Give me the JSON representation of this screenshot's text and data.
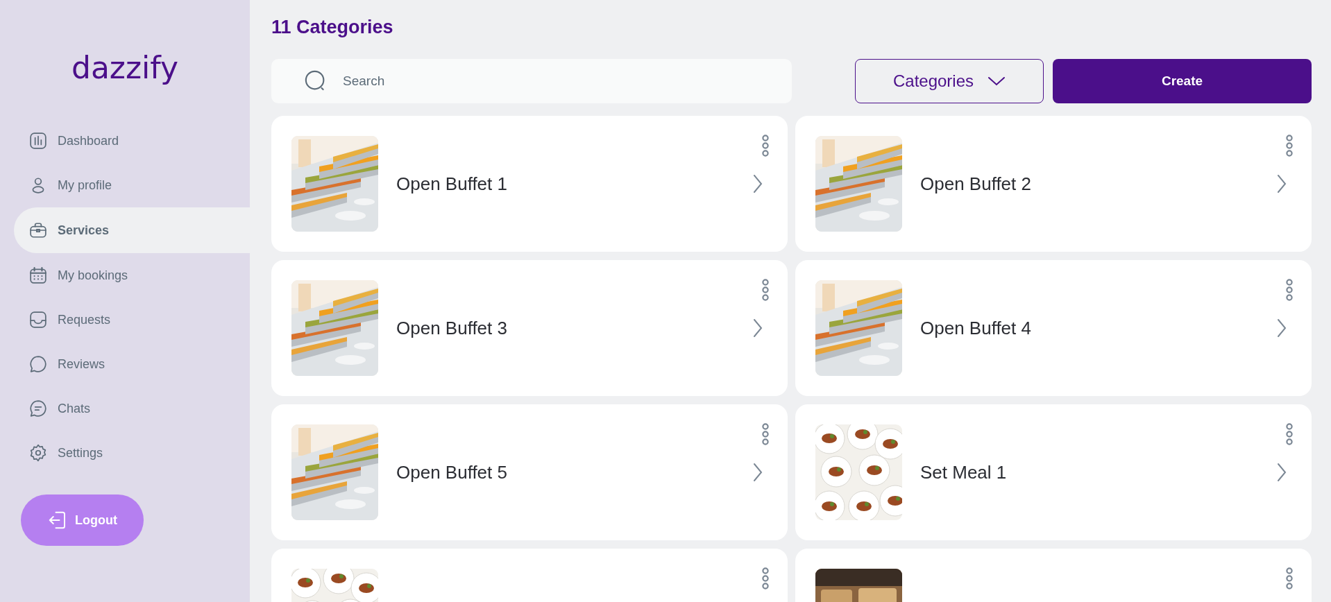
{
  "sidebar": {
    "logo": "dazzify",
    "items": [
      {
        "label": "Dashboard",
        "selected": false
      },
      {
        "label": "My profile",
        "selected": false
      },
      {
        "label": "Services",
        "selected": true
      },
      {
        "label": "My bookings",
        "selected": false
      },
      {
        "label": "Requests",
        "selected": false
      },
      {
        "label": "Reviews",
        "selected": false
      },
      {
        "label": "Chats",
        "selected": false
      },
      {
        "label": "Settings",
        "selected": false
      }
    ],
    "logout": "Logout"
  },
  "header": {
    "title": "11 Categories",
    "search": {
      "placeholder": "Search"
    },
    "filter": "Categories",
    "create": "Create"
  },
  "cards": [
    {
      "title": "Open Buffet 1",
      "image": {
        "kind": "picture"
      }
    },
    {
      "title": "Open Buffet 2",
      "image": {
        "kind": "picture"
      }
    },
    {
      "title": "Open Buffet 3",
      "image": {
        "kind": "picture"
      }
    },
    {
      "title": "Open Buffet 4",
      "image": {
        "kind": "picture"
      }
    },
    {
      "title": "Open Buffet 5",
      "image": {
        "kind": "picture"
      }
    },
    {
      "title": "Set Meal 1",
      "image": {
        "kind": "picture"
      }
    },
    {
      "image": {
        "kind": "picture"
      }
    },
    {
      "image": {
        "kind": "picture"
      }
    }
  ]
}
